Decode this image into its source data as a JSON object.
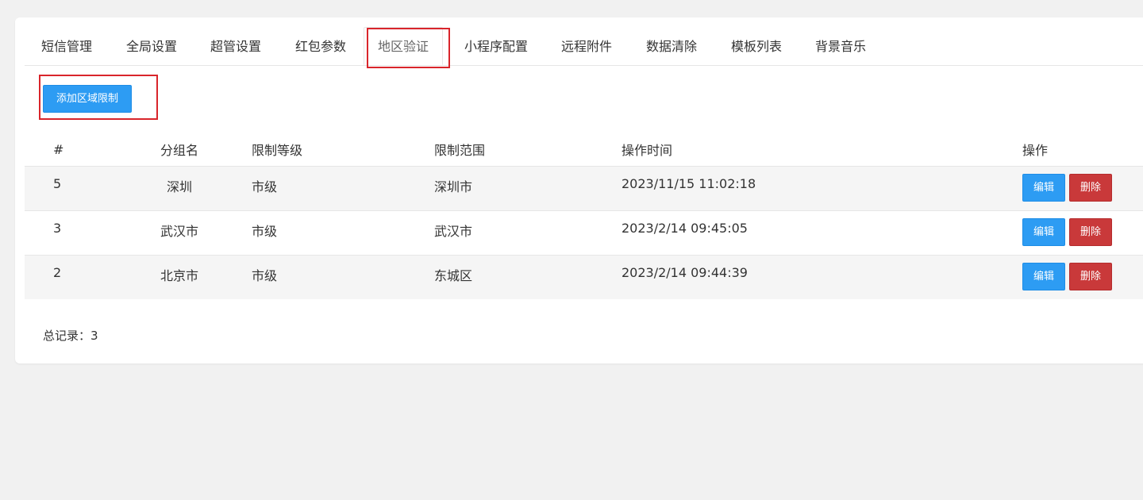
{
  "tabs": [
    {
      "label": "短信管理"
    },
    {
      "label": "全局设置"
    },
    {
      "label": "超管设置"
    },
    {
      "label": "红包参数"
    },
    {
      "label": "地区验证"
    },
    {
      "label": "小程序配置"
    },
    {
      "label": "远程附件"
    },
    {
      "label": "数据清除"
    },
    {
      "label": "模板列表"
    },
    {
      "label": "背景音乐"
    }
  ],
  "active_tab": "地区验证",
  "add_button_label": "添加区域限制",
  "table": {
    "headers": [
      "#",
      "分组名",
      "限制等级",
      "限制范围",
      "操作时间",
      "操作"
    ],
    "rows": [
      {
        "id": "5",
        "group": "深圳",
        "level": "市级",
        "range": "深圳市",
        "time": "2023/11/15 11:02:18",
        "edit": "编辑",
        "delete": "删除"
      },
      {
        "id": "3",
        "group": "武汉市",
        "level": "市级",
        "range": "武汉市",
        "time": "2023/2/14 09:45:05",
        "edit": "编辑",
        "delete": "删除"
      },
      {
        "id": "2",
        "group": "北京市",
        "level": "市级",
        "range": "东城区",
        "time": "2023/2/14 09:44:39",
        "edit": "编辑",
        "delete": "删除"
      }
    ]
  },
  "total_label": "总记录：3",
  "colors": {
    "primary": "#2d9cf3",
    "danger": "#c9393a",
    "highlight": "#d9252b"
  }
}
